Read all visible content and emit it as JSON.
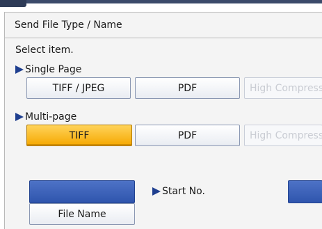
{
  "header": {
    "title": "Send File Type / Name"
  },
  "prompt": "Select item.",
  "single_page": {
    "label": "Single Page",
    "options": [
      "TIFF / JPEG",
      "PDF",
      "High Compression"
    ]
  },
  "multi_page": {
    "label": "Multi-page",
    "options": [
      "TIFF",
      "PDF",
      "High Compression"
    ],
    "selected": "TIFF"
  },
  "file_name_button": "File Name",
  "start_no_label": "Start No.",
  "colors": {
    "accent_blue": "#2f55ad",
    "selected_orange": "#f5a800",
    "arrow_blue": "#1f3f8f",
    "panel_bg": "#f4f4f4"
  },
  "icons": {
    "section_arrow": "right-triangle-icon"
  }
}
